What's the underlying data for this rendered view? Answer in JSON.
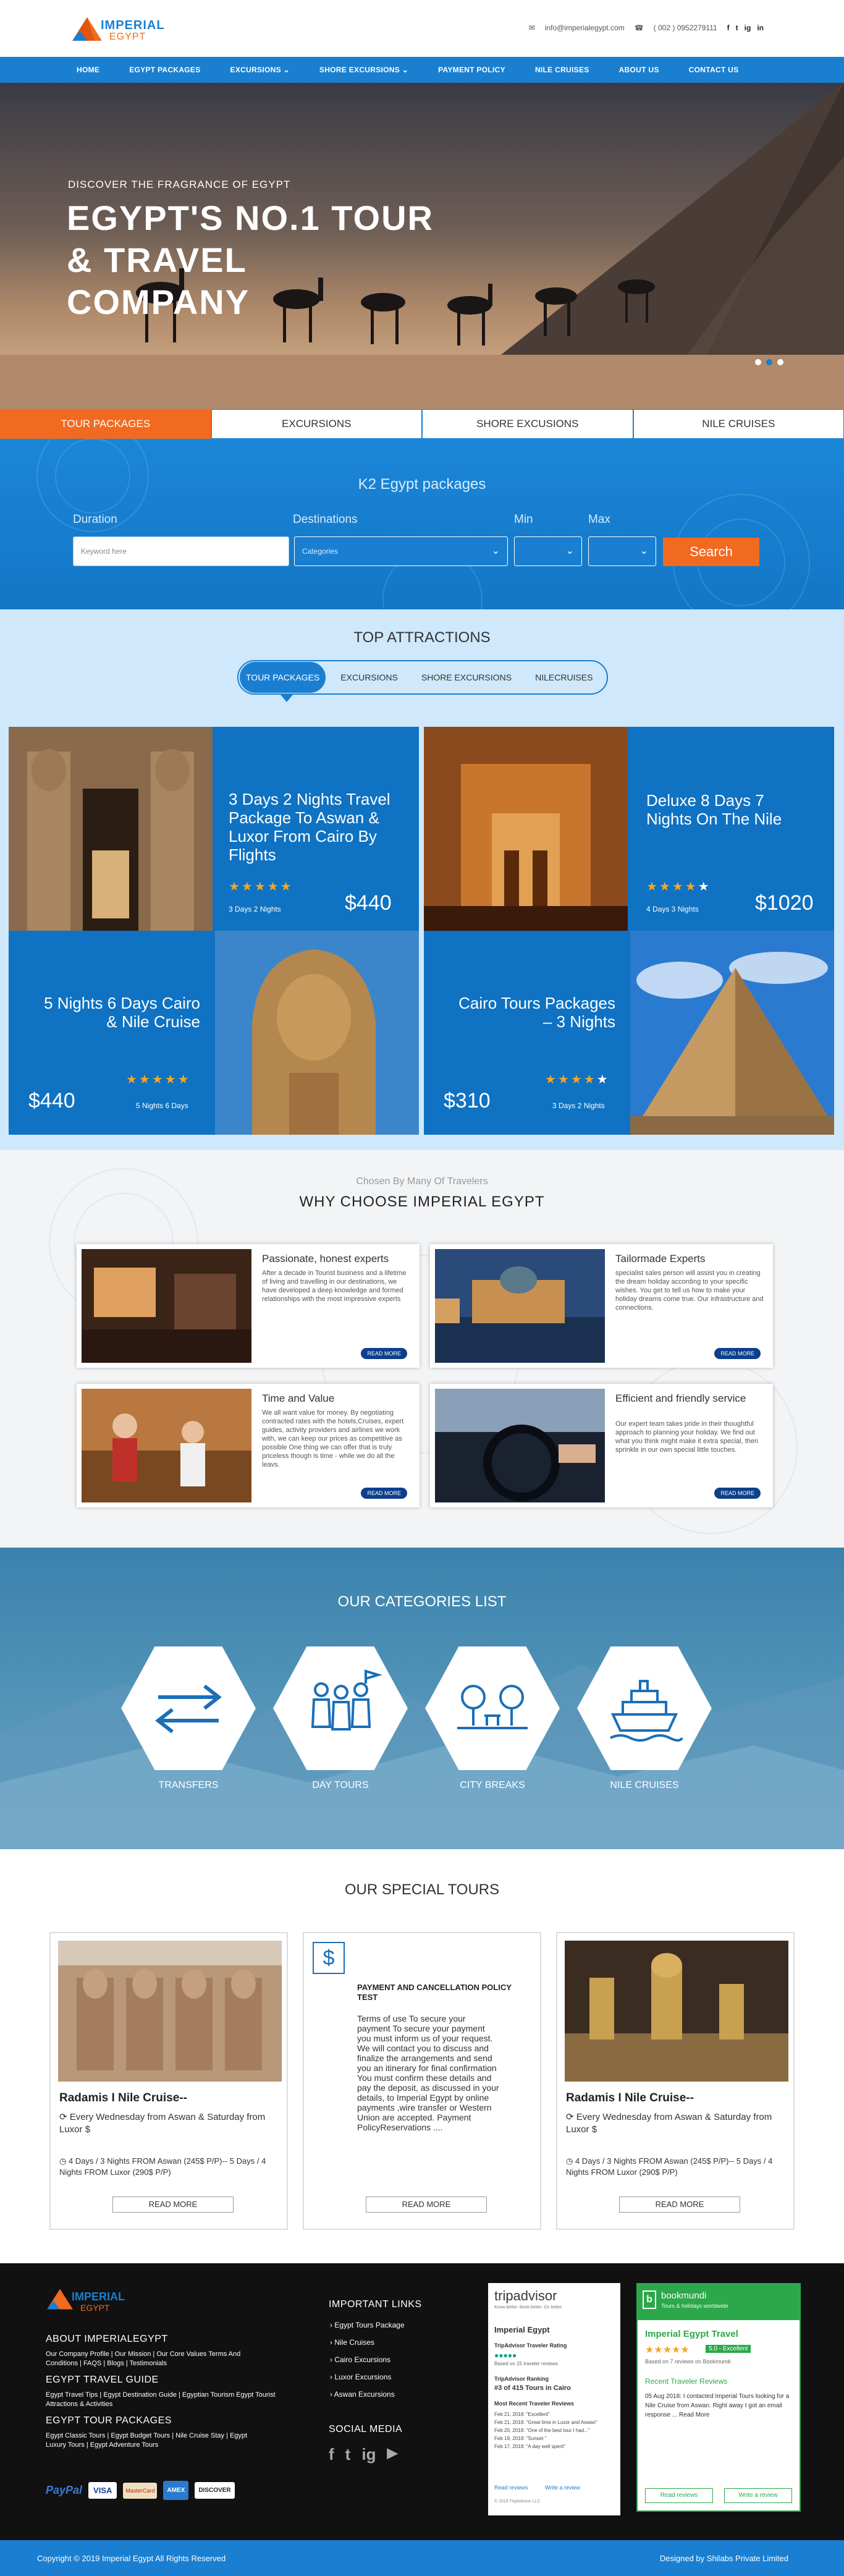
{
  "header": {
    "logo_line1": "IMPERIAL",
    "logo_line2": "EGYPT",
    "email": "info@imperialegypt.com",
    "phone": "( 002 ) 0952279111",
    "social": [
      "f",
      "t",
      "ig",
      "in"
    ]
  },
  "nav": [
    "HOME",
    "EGYPT PACKAGES",
    "EXCURSIONS",
    "SHORE EXCURSIONS",
    "PAYMENT POLICY",
    "NILE CRUISES",
    "ABOUT US",
    "CONTACT US"
  ],
  "hero": {
    "subtitle": "DISCOVER THE FRAGRANCE OF EGYPT",
    "title": "EGYPT'S NO.1 TOUR & TRAVEL COMPANY"
  },
  "tabs": [
    "TOUR PACKAGES",
    "EXCURSIONS",
    "SHORE EXCUSIONS",
    "NILE CRUISES"
  ],
  "search": {
    "title": "K2 Egypt packages",
    "duration_label": "Duration",
    "destinations_label": "Destinations",
    "min_label": "Min",
    "max_label": "Max",
    "keyword_placeholder": "Keyword here",
    "category_placeholder": "Categories",
    "button": "Search"
  },
  "attractions": {
    "title": "TOP ATTRACTIONS",
    "filters": [
      "TOUR PACKAGES",
      "EXCURSIONS",
      "SHORE EXCURSIONS",
      "NILECRUISES"
    ],
    "cards": [
      {
        "title": "3 Days 2 Nights Travel Package To Aswan & Luxor From Cairo By Flights",
        "duration": "3 Days 2 Nights",
        "price": "$440",
        "stars": 5
      },
      {
        "title": "Deluxe 8 Days 7 Nights On The Nile",
        "duration": "4 Days 3 Nights",
        "price": "$1020",
        "stars": 4
      },
      {
        "title": "5 Nights 6 Days Cairo & Nile Cruise",
        "duration": "5 Nights 6 Days",
        "price": "$440",
        "stars": 5
      },
      {
        "title": "Cairo Tours Packages – 3 Nights",
        "duration": "3 Days 2 Nights",
        "price": "$310",
        "stars": 4
      }
    ]
  },
  "why": {
    "subtitle": "Chosen By Many Of Travelers",
    "title": "WHY CHOOSE IMPERIAL EGYPT",
    "boxes": [
      {
        "heading": "Passionate, honest experts",
        "text": "After a decade in Tourist business and a lifetime of living and travelling in our destinations, we have developed a deep knowledge and formed relationships with the most impressive experts",
        "button": "READ MORE"
      },
      {
        "heading": "Tailormade Experts",
        "text": "specialist sales person will assist you in creating the dream holiday according to your specific wishes. You get to tell us how to make your holiday dreams come true. Our infrastructure and connections.",
        "button": "READ MORE"
      },
      {
        "heading": "Time and Value",
        "text": "We all want value for money. By negotiating contracted rates with the hotels,Cruises, expert guides, activity providers and airlines we work with, we can keep our prices as competitive as possible One thing we can offer that is truly priceless though is time - while we do all the leavs.",
        "button": "READ MORE"
      },
      {
        "heading": "Efficient and friendly service",
        "text": "Our expert team takes pride in their thoughtful approach to planning your holiday. We find out what you think might make it extra special, then sprinkle in our own special little touches.",
        "button": "READ MORE"
      }
    ]
  },
  "categories": {
    "title": "OUR CATEGORIES LIST",
    "items": [
      "TRANSFERS",
      "DAY TOURS",
      "CITY BREAKS",
      "NILE CRUISES"
    ]
  },
  "special": {
    "title": "OUR SPECIAL TOURS",
    "tours": [
      {
        "heading": "Radamis I Nile Cruise--",
        "desc": "Every Wednesday from Aswan & Saturday from Luxor $",
        "info": "4 Days / 3 Nights FROM Aswan (245$ P/P)-- 5 Days / 4 Nights FROM Luxor (290$ P/P)",
        "button": "READ MORE"
      },
      {
        "heading": "PAYMENT AND CANCELLATION POLICY TEST",
        "desc": "Terms of use To secure your payment To secure your payment you must inform us of your request. We will contact you to discuss and finalize the arrangements and send you an itinerary for final confirmation You must confirm these details and pay the deposit, as discussed in your details, to Imperial Egypt by online payments ,wire transfer or Western Union are accepted. Payment PolicyReservations ....",
        "button": "READ MORE"
      },
      {
        "heading": "Radamis I Nile Cruise--",
        "desc": "Every Wednesday from Aswan & Saturday from Luxor $",
        "info": "4 Days / 3 Nights FROM Aswan (245$ P/P)-- 5 Days / 4 Nights FROM Luxor (290$ P/P)",
        "button": "READ MORE"
      }
    ]
  },
  "footer": {
    "about_title": "ABOUT IMPERIALEGYPT",
    "about_links": "Our Company Profile | Our Mission | Our Core Values Terms And Conditions | FAQS | Blogs | Testimonials",
    "guide_title": "EGYPT TRAVEL GUIDE",
    "guide_links": "Egypt Travel Tips | Egypt Destination Guide | Egyptian Tourism Egypt Tourist Attractions & Activities",
    "pkg_title": "EGYPT TOUR PACKAGES",
    "pkg_links": "Egypt Classic Tours | Egypt Budget Tours | Nile Cruise Stay | Egypt Luxury Tours | Egypt Adventure Tours",
    "payments": [
      "PayPal",
      "VISA",
      "MasterCard",
      "AMEX",
      "DISCOVER"
    ],
    "links_title": "IMPORTANT LINKS",
    "links": [
      "Egypt Tours Package",
      "Nile Cruises",
      "Cairo Excursions",
      "Luxor Excursions",
      "Aswan Excursions"
    ],
    "social_title": "SOCIAL MEDIA",
    "tripadvisor": {
      "brand": "tripadvisor",
      "tagline": "Know better. Book better. Go better.",
      "name": "Imperial Egypt",
      "rating_label": "TripAdvisor Traveler Rating",
      "reviews": "Based on 15 traveler reviews",
      "ranking_label": "TripAdvisor Ranking",
      "ranking": "#3 of 415 Tours in Cairo",
      "recent_label": "Most Recent Traveler Reviews",
      "recent": [
        "Feb 21, 2018: \"Excellent\"",
        "Feb 21, 2018: \"Great time in Luxor and Aswan\"",
        "Feb 20, 2018: \"One of the best tour I had...\"",
        "Feb 19, 2018: \"Sunset \"",
        "Feb 17, 2018: \"A day well spent\""
      ],
      "read": "Read reviews",
      "write": "Write a review",
      "copyright": "© 2019 TripAdvisor LLC"
    },
    "bookmundi": {
      "brand": "bookmundi",
      "tagline": "Tours & holidays worldwide",
      "name": "Imperial Egypt Travel",
      "score": "5.0 - Excellent",
      "based": "Based on 7 reviews on Bookmundi",
      "recent_label": "Recent Traveler Reviews",
      "review": "05 Aug 2018: I contacted Imperial Tours looking for a Nile Cruise from Aswan. Right away I got an email response ... Read More",
      "read": "Read reviews",
      "write": "Write a review"
    }
  },
  "copyright": {
    "left": "Copyright © 2019 Imperial Egypt All Rights Reserved",
    "right": "Designed by Shilabs Private Limited"
  },
  "colors": {
    "primary": "#1a7fd1",
    "accent": "#f26a1f",
    "dark": "#111111"
  }
}
